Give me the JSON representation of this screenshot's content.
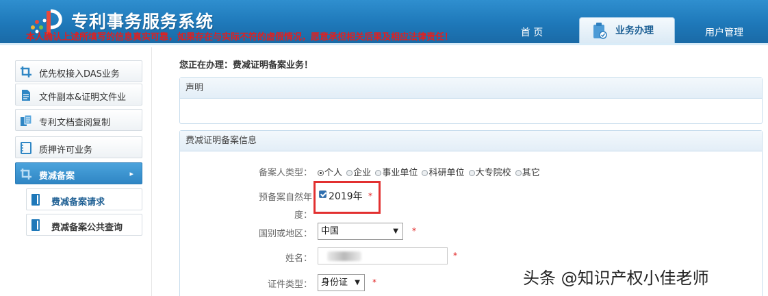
{
  "header": {
    "app_title": "专利事务服务系统",
    "nav": {
      "home": "首 页",
      "business": "业务办理",
      "users": "用户管理"
    }
  },
  "sidebar": {
    "items": [
      {
        "label": "优先权接入DAS业务",
        "icon": "crop-icon"
      },
      {
        "label": "文件副本&证明文件业",
        "icon": "document-icon"
      },
      {
        "label": "专利文档查阅复制",
        "icon": "copy-document-icon"
      },
      {
        "label": "质押许可业务",
        "icon": "frame-icon"
      },
      {
        "label": "费减备案",
        "icon": "crop-icon",
        "active": true
      }
    ],
    "sub_items": [
      {
        "label": "费减备案请求",
        "current": true
      },
      {
        "label": "费减备案公共查询"
      }
    ]
  },
  "main": {
    "doing_text": "您正在办理：费减证明备案业务！",
    "statement": {
      "title": "声明",
      "text": "本人确认上述所填写的信息真实可靠，如果存在与实际不符的虚假情况，愿意承担相关后果及相应法律责任！"
    },
    "form": {
      "title": "费减证明备案信息",
      "type_label": "备案人类型：",
      "type_options": [
        "个人",
        "企业",
        "事业单位",
        "科研单位",
        "大专院校",
        "其它"
      ],
      "type_selected": "个人",
      "year_label_line1": "预备案自然年",
      "year_label_line2": "度：",
      "year_value": "2019年",
      "year_checked": true,
      "country_label": "国别或地区：",
      "country_value": "中国",
      "name_label": "姓名：",
      "id_type_label": "证件类型：",
      "id_type_value": "身份证",
      "required_mark": "*"
    }
  },
  "watermark": "头条 @知识产权小佳老师",
  "colors": {
    "header_blue": "#1e78b9",
    "active_blue": "#2f86c4",
    "warning_red": "#e02020",
    "highlight_red": "#e23030"
  }
}
